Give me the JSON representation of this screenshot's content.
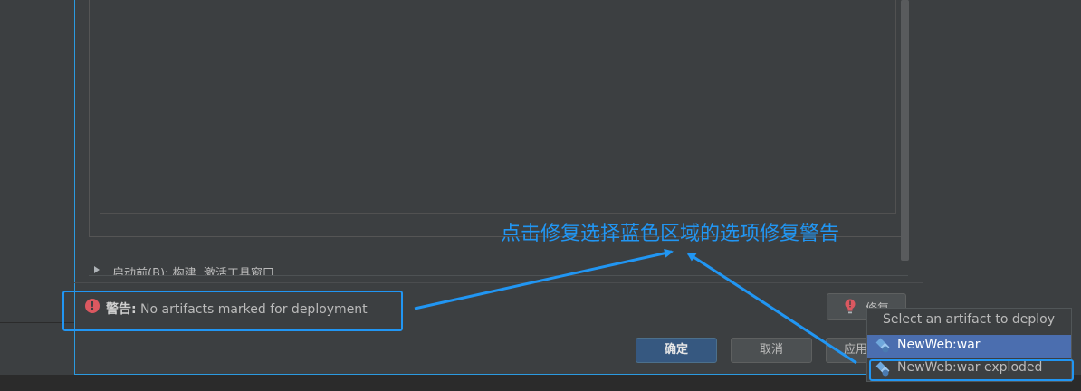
{
  "dialog": {
    "before_launch_label": "启动前(B): 构建, 激活工具窗口"
  },
  "warning": {
    "prefix": "警告:",
    "message": " No artifacts marked for deployment"
  },
  "fix_button": {
    "label": "修复"
  },
  "buttons": {
    "ok": "确定",
    "cancel": "取消",
    "apply": "应用"
  },
  "popup": {
    "title": "Select an artifact to deploy",
    "items": [
      {
        "label": "NewWeb:war",
        "selected": true
      },
      {
        "label": "NewWeb:war exploded",
        "selected": false
      }
    ]
  },
  "annotation": {
    "text": "点击修复选择蓝色区域的选项修复警告",
    "color": "#2196f3"
  },
  "colors": {
    "accent": "#2196f3",
    "error": "#db5860",
    "selection": "#4b6eaf",
    "primary_button": "#365880"
  },
  "icons": {
    "warning": "error-circle-icon",
    "fix": "lightbulb-error-icon",
    "artifact": "artifact-icon",
    "expand": "expand-triangle-icon"
  }
}
